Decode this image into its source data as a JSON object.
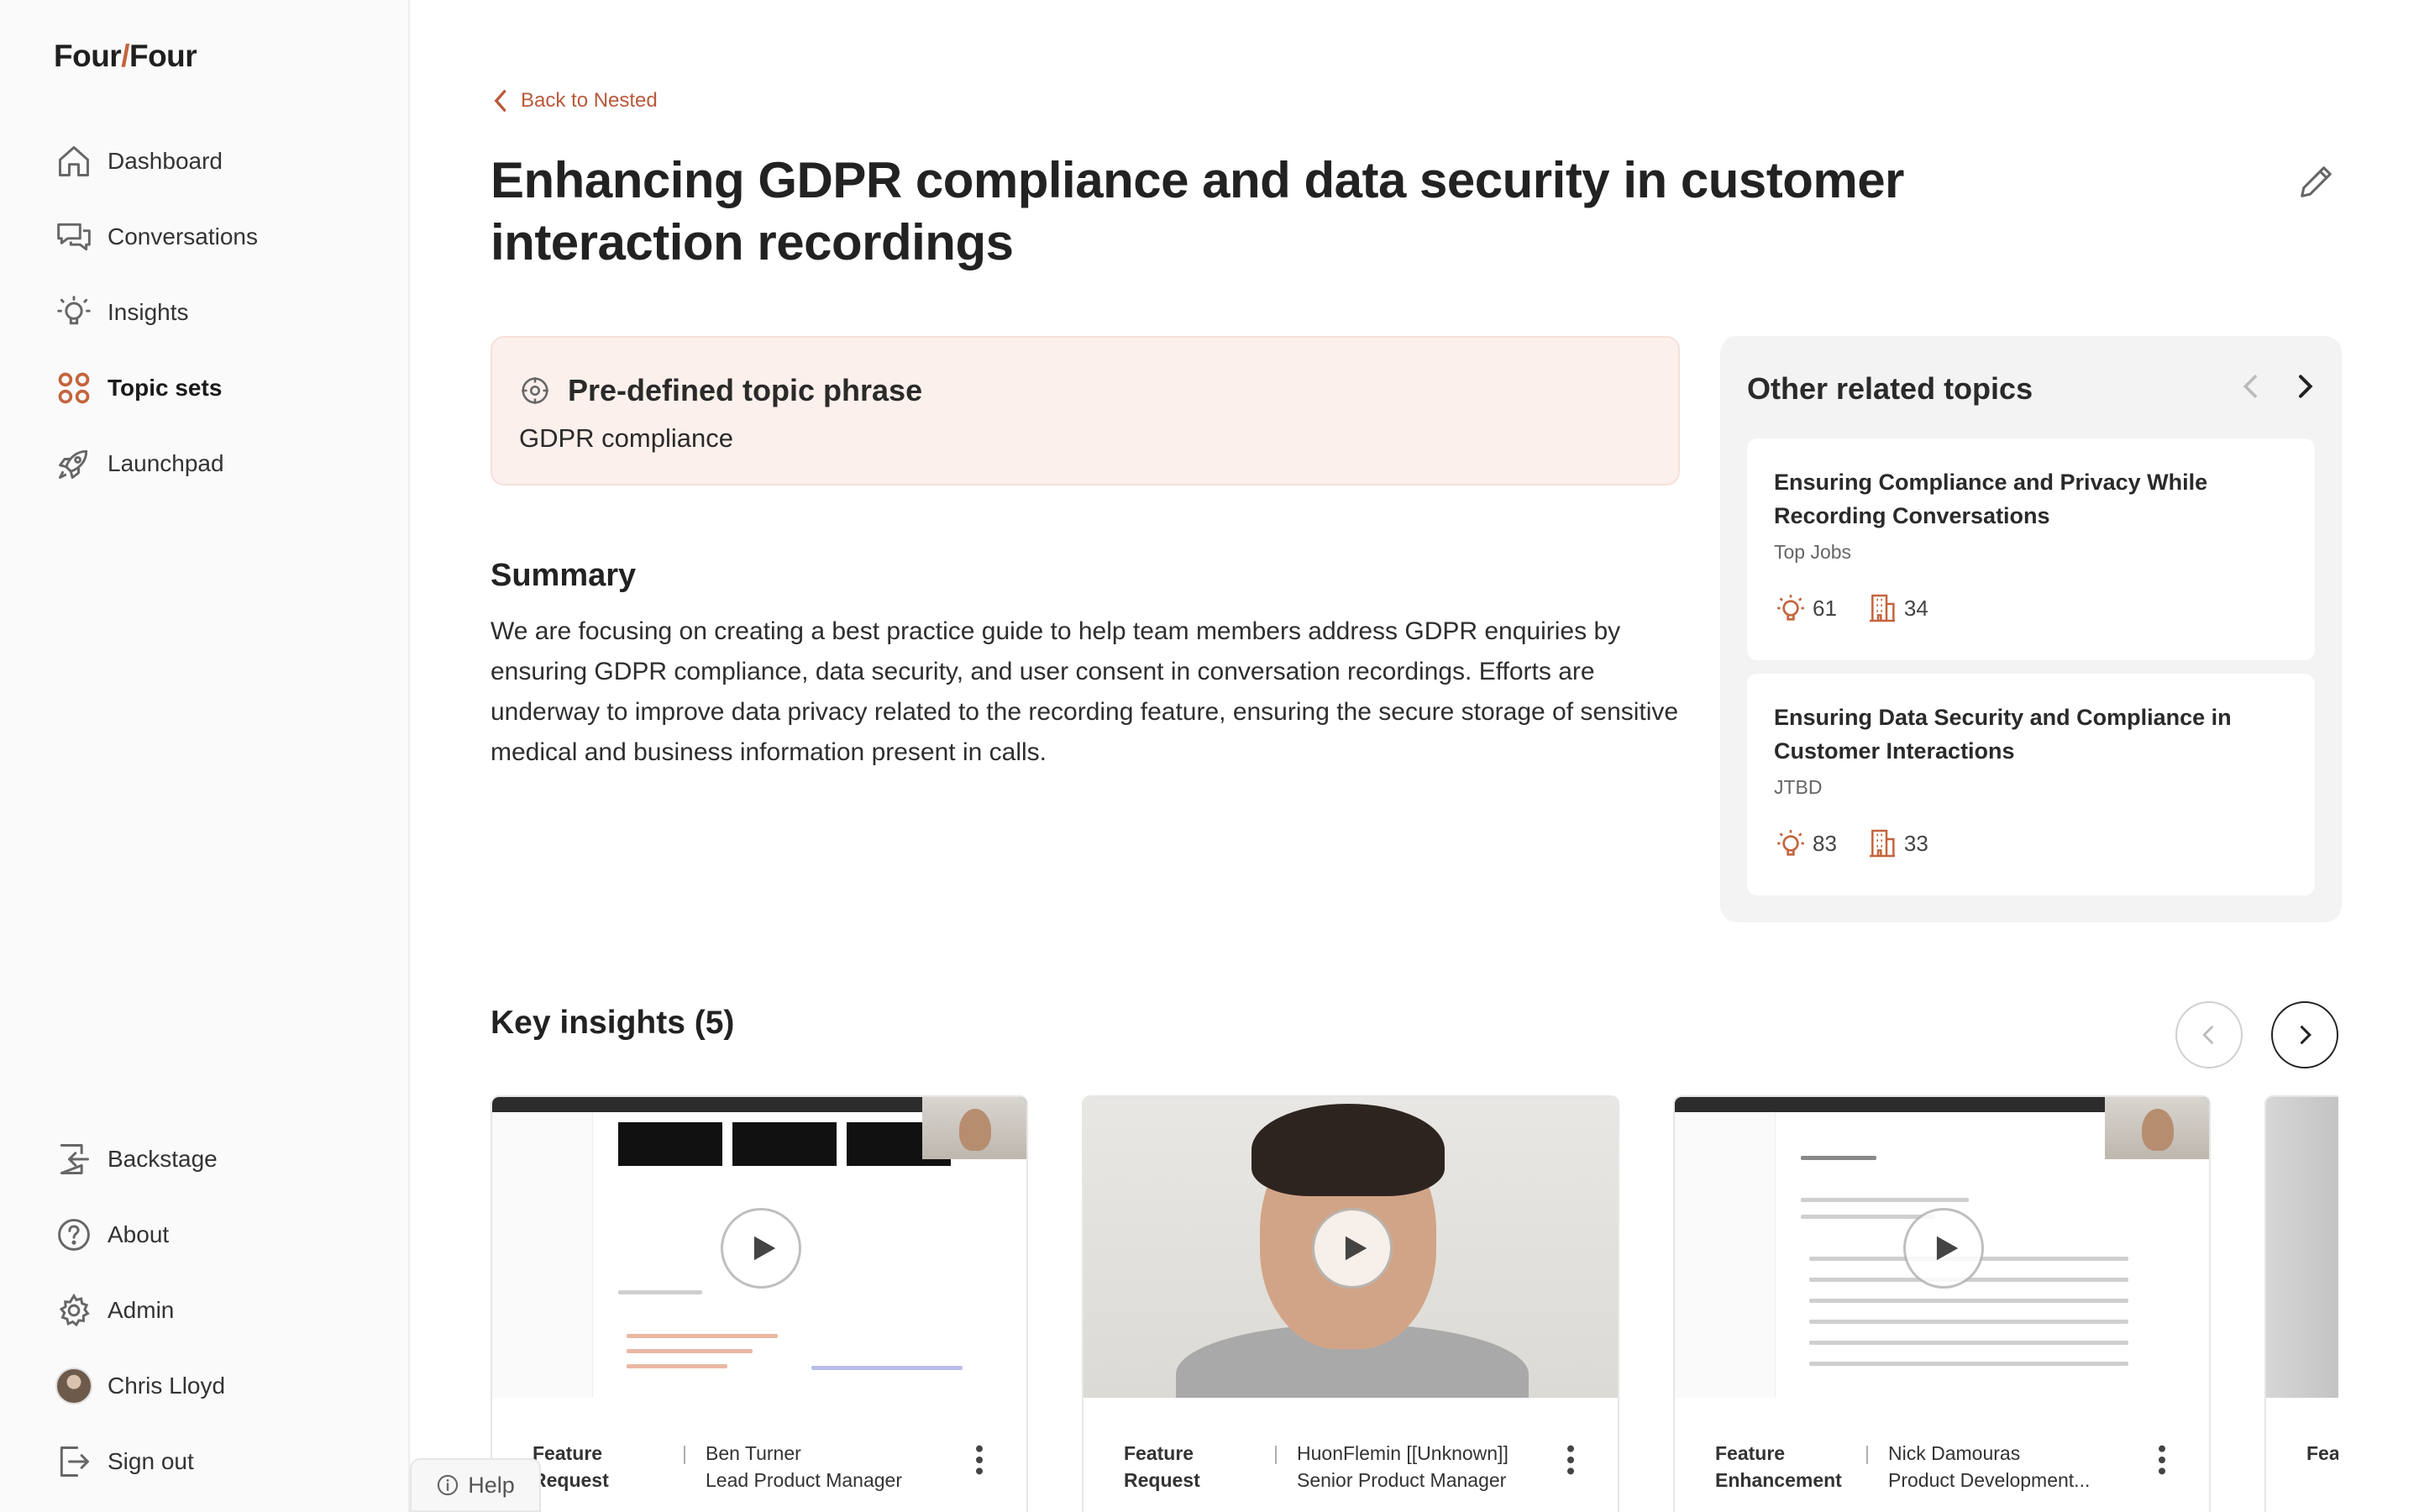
{
  "app": {
    "logo_left": "Four",
    "logo_slash": "/",
    "logo_right": "Four"
  },
  "sidebar": {
    "items": [
      {
        "label": "Dashboard",
        "icon": "home-icon"
      },
      {
        "label": "Conversations",
        "icon": "chat-icon"
      },
      {
        "label": "Insights",
        "icon": "lightbulb-icon"
      },
      {
        "label": "Topic sets",
        "icon": "grid-icon",
        "active": true
      },
      {
        "label": "Launchpad",
        "icon": "rocket-icon"
      }
    ],
    "bottom_items": [
      {
        "label": "Backstage",
        "icon": "enter-icon"
      },
      {
        "label": "About",
        "icon": "question-icon"
      },
      {
        "label": "Admin",
        "icon": "gear-icon"
      },
      {
        "label": "Chris Lloyd",
        "icon": "avatar"
      },
      {
        "label": "Sign out",
        "icon": "sign-out-icon"
      }
    ]
  },
  "header": {
    "back_label": "Back to Nested",
    "title": "Enhancing GDPR compliance and data security in customer interaction recordings"
  },
  "phrase": {
    "heading": "Pre-defined topic phrase",
    "value": "GDPR compliance"
  },
  "summary": {
    "heading": "Summary",
    "text": "We are focusing on creating a best practice guide to help team members address GDPR enquiries by ensuring GDPR compliance, data security, and user consent in conversation recordings. Efforts are underway to improve data privacy related to the recording feature, ensuring the secure storage of sensitive medical and business information present in calls."
  },
  "related": {
    "heading": "Other related topics",
    "cards": [
      {
        "title": "Ensuring Compliance and Privacy While Recording Conversations",
        "set": "Top Jobs",
        "insights": "61",
        "companies": "34"
      },
      {
        "title": "Ensuring Data Security and Compliance in Customer Interactions",
        "set": "JTBD",
        "insights": "83",
        "companies": "33"
      }
    ]
  },
  "key_insights": {
    "heading": "Key insights (5)",
    "cards": [
      {
        "category": "Feature Request",
        "name": "Ben Turner",
        "role": "Lead Product Manager"
      },
      {
        "category": "Feature Request",
        "name": "HuonFlemin [[Unknown]]",
        "role": "Senior Product Manager"
      },
      {
        "category": "Feature Enhancement",
        "name": "Nick Damouras",
        "role": "Product Development..."
      },
      {
        "category": "Feat",
        "name": "",
        "role": ""
      }
    ]
  },
  "help": {
    "label": "Help"
  },
  "colors": {
    "accent": "#c4643c",
    "phrase_bg": "#fcf0ec",
    "related_bg": "#f3f3f3"
  }
}
